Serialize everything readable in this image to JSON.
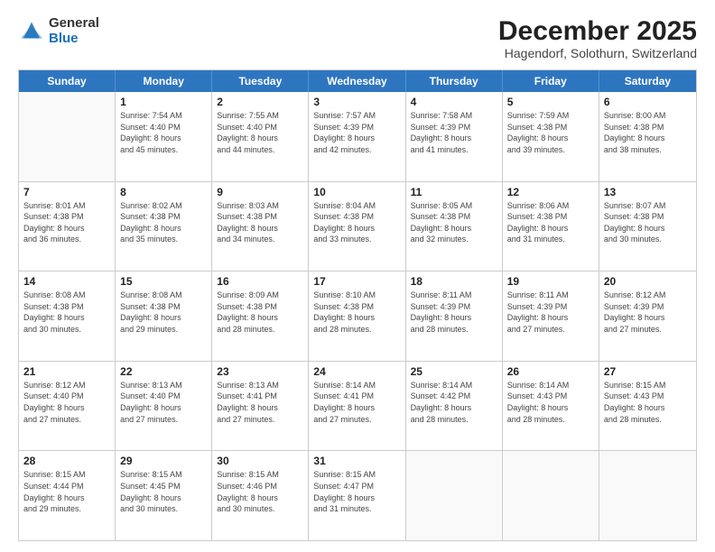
{
  "header": {
    "logo_general": "General",
    "logo_blue": "Blue",
    "title": "December 2025",
    "subtitle": "Hagendorf, Solothurn, Switzerland"
  },
  "calendar": {
    "days_of_week": [
      "Sunday",
      "Monday",
      "Tuesday",
      "Wednesday",
      "Thursday",
      "Friday",
      "Saturday"
    ],
    "weeks": [
      [
        {
          "day": "",
          "lines": []
        },
        {
          "day": "1",
          "lines": [
            "Sunrise: 7:54 AM",
            "Sunset: 4:40 PM",
            "Daylight: 8 hours",
            "and 45 minutes."
          ]
        },
        {
          "day": "2",
          "lines": [
            "Sunrise: 7:55 AM",
            "Sunset: 4:40 PM",
            "Daylight: 8 hours",
            "and 44 minutes."
          ]
        },
        {
          "day": "3",
          "lines": [
            "Sunrise: 7:57 AM",
            "Sunset: 4:39 PM",
            "Daylight: 8 hours",
            "and 42 minutes."
          ]
        },
        {
          "day": "4",
          "lines": [
            "Sunrise: 7:58 AM",
            "Sunset: 4:39 PM",
            "Daylight: 8 hours",
            "and 41 minutes."
          ]
        },
        {
          "day": "5",
          "lines": [
            "Sunrise: 7:59 AM",
            "Sunset: 4:38 PM",
            "Daylight: 8 hours",
            "and 39 minutes."
          ]
        },
        {
          "day": "6",
          "lines": [
            "Sunrise: 8:00 AM",
            "Sunset: 4:38 PM",
            "Daylight: 8 hours",
            "and 38 minutes."
          ]
        }
      ],
      [
        {
          "day": "7",
          "lines": [
            "Sunrise: 8:01 AM",
            "Sunset: 4:38 PM",
            "Daylight: 8 hours",
            "and 36 minutes."
          ]
        },
        {
          "day": "8",
          "lines": [
            "Sunrise: 8:02 AM",
            "Sunset: 4:38 PM",
            "Daylight: 8 hours",
            "and 35 minutes."
          ]
        },
        {
          "day": "9",
          "lines": [
            "Sunrise: 8:03 AM",
            "Sunset: 4:38 PM",
            "Daylight: 8 hours",
            "and 34 minutes."
          ]
        },
        {
          "day": "10",
          "lines": [
            "Sunrise: 8:04 AM",
            "Sunset: 4:38 PM",
            "Daylight: 8 hours",
            "and 33 minutes."
          ]
        },
        {
          "day": "11",
          "lines": [
            "Sunrise: 8:05 AM",
            "Sunset: 4:38 PM",
            "Daylight: 8 hours",
            "and 32 minutes."
          ]
        },
        {
          "day": "12",
          "lines": [
            "Sunrise: 8:06 AM",
            "Sunset: 4:38 PM",
            "Daylight: 8 hours",
            "and 31 minutes."
          ]
        },
        {
          "day": "13",
          "lines": [
            "Sunrise: 8:07 AM",
            "Sunset: 4:38 PM",
            "Daylight: 8 hours",
            "and 30 minutes."
          ]
        }
      ],
      [
        {
          "day": "14",
          "lines": [
            "Sunrise: 8:08 AM",
            "Sunset: 4:38 PM",
            "Daylight: 8 hours",
            "and 30 minutes."
          ]
        },
        {
          "day": "15",
          "lines": [
            "Sunrise: 8:08 AM",
            "Sunset: 4:38 PM",
            "Daylight: 8 hours",
            "and 29 minutes."
          ]
        },
        {
          "day": "16",
          "lines": [
            "Sunrise: 8:09 AM",
            "Sunset: 4:38 PM",
            "Daylight: 8 hours",
            "and 28 minutes."
          ]
        },
        {
          "day": "17",
          "lines": [
            "Sunrise: 8:10 AM",
            "Sunset: 4:38 PM",
            "Daylight: 8 hours",
            "and 28 minutes."
          ]
        },
        {
          "day": "18",
          "lines": [
            "Sunrise: 8:11 AM",
            "Sunset: 4:39 PM",
            "Daylight: 8 hours",
            "and 28 minutes."
          ]
        },
        {
          "day": "19",
          "lines": [
            "Sunrise: 8:11 AM",
            "Sunset: 4:39 PM",
            "Daylight: 8 hours",
            "and 27 minutes."
          ]
        },
        {
          "day": "20",
          "lines": [
            "Sunrise: 8:12 AM",
            "Sunset: 4:39 PM",
            "Daylight: 8 hours",
            "and 27 minutes."
          ]
        }
      ],
      [
        {
          "day": "21",
          "lines": [
            "Sunrise: 8:12 AM",
            "Sunset: 4:40 PM",
            "Daylight: 8 hours",
            "and 27 minutes."
          ]
        },
        {
          "day": "22",
          "lines": [
            "Sunrise: 8:13 AM",
            "Sunset: 4:40 PM",
            "Daylight: 8 hours",
            "and 27 minutes."
          ]
        },
        {
          "day": "23",
          "lines": [
            "Sunrise: 8:13 AM",
            "Sunset: 4:41 PM",
            "Daylight: 8 hours",
            "and 27 minutes."
          ]
        },
        {
          "day": "24",
          "lines": [
            "Sunrise: 8:14 AM",
            "Sunset: 4:41 PM",
            "Daylight: 8 hours",
            "and 27 minutes."
          ]
        },
        {
          "day": "25",
          "lines": [
            "Sunrise: 8:14 AM",
            "Sunset: 4:42 PM",
            "Daylight: 8 hours",
            "and 28 minutes."
          ]
        },
        {
          "day": "26",
          "lines": [
            "Sunrise: 8:14 AM",
            "Sunset: 4:43 PM",
            "Daylight: 8 hours",
            "and 28 minutes."
          ]
        },
        {
          "day": "27",
          "lines": [
            "Sunrise: 8:15 AM",
            "Sunset: 4:43 PM",
            "Daylight: 8 hours",
            "and 28 minutes."
          ]
        }
      ],
      [
        {
          "day": "28",
          "lines": [
            "Sunrise: 8:15 AM",
            "Sunset: 4:44 PM",
            "Daylight: 8 hours",
            "and 29 minutes."
          ]
        },
        {
          "day": "29",
          "lines": [
            "Sunrise: 8:15 AM",
            "Sunset: 4:45 PM",
            "Daylight: 8 hours",
            "and 30 minutes."
          ]
        },
        {
          "day": "30",
          "lines": [
            "Sunrise: 8:15 AM",
            "Sunset: 4:46 PM",
            "Daylight: 8 hours",
            "and 30 minutes."
          ]
        },
        {
          "day": "31",
          "lines": [
            "Sunrise: 8:15 AM",
            "Sunset: 4:47 PM",
            "Daylight: 8 hours",
            "and 31 minutes."
          ]
        },
        {
          "day": "",
          "lines": []
        },
        {
          "day": "",
          "lines": []
        },
        {
          "day": "",
          "lines": []
        }
      ]
    ]
  }
}
